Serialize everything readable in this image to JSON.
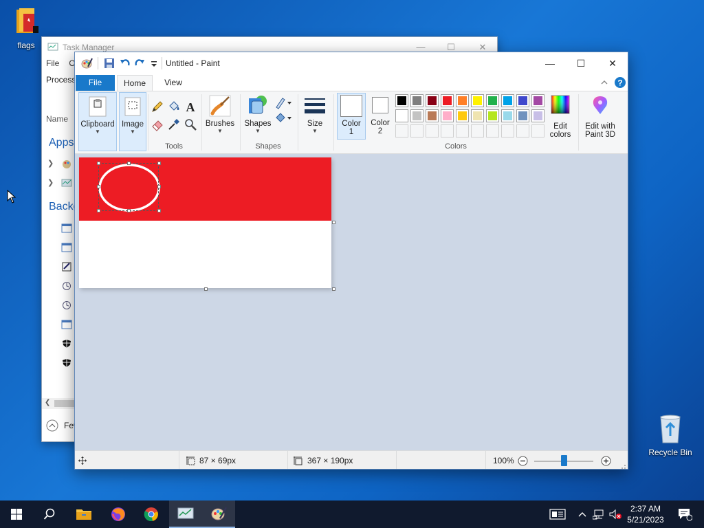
{
  "desktop": {
    "icons": [
      {
        "label": "flags"
      },
      {
        "label": "Recycle Bin"
      }
    ]
  },
  "task_manager": {
    "title": "Task Manager",
    "menu": [
      "File",
      "O"
    ],
    "tab": "Process",
    "column": "Name",
    "sections": [
      "Apps",
      "Backg"
    ],
    "footer": "Few"
  },
  "paint": {
    "title": "Untitled - Paint",
    "tabs": {
      "file": "File",
      "home": "Home",
      "view": "View"
    },
    "ribbon": {
      "clipboard": "Clipboard",
      "image": "Image",
      "tools_group": "Tools",
      "brushes": "Brushes",
      "shapes": "Shapes",
      "shapes_group": "Shapes",
      "size": "Size",
      "color1": "Color\n1",
      "color1_line1": "Color",
      "color1_line2": "1",
      "color2_line1": "Color",
      "color2_line2": "2",
      "colors_group": "Colors",
      "edit_colors_line1": "Edit",
      "edit_colors_line2": "colors",
      "paint3d_line1": "Edit with",
      "paint3d_line2": "Paint 3D"
    },
    "palette_row1": [
      "#000000",
      "#7f7f7f",
      "#880015",
      "#ed1c24",
      "#ff7f27",
      "#fff200",
      "#22b14c",
      "#00a2e8",
      "#3f48cc",
      "#a349a4"
    ],
    "palette_row2": [
      "#ffffff",
      "#c3c3c3",
      "#b97a57",
      "#ffaec9",
      "#ffc90e",
      "#efe4b0",
      "#b5e61d",
      "#99d9ea",
      "#7092be",
      "#c8bfe7"
    ],
    "status": {
      "selection_size": "87 × 69px",
      "image_size": "367 × 190px",
      "zoom": "100%"
    },
    "image_colors": {
      "top": "#ed1c24",
      "bottom": "#ffffff"
    }
  },
  "taskbar": {
    "time": "2:37 AM",
    "date": "5/21/2023"
  }
}
